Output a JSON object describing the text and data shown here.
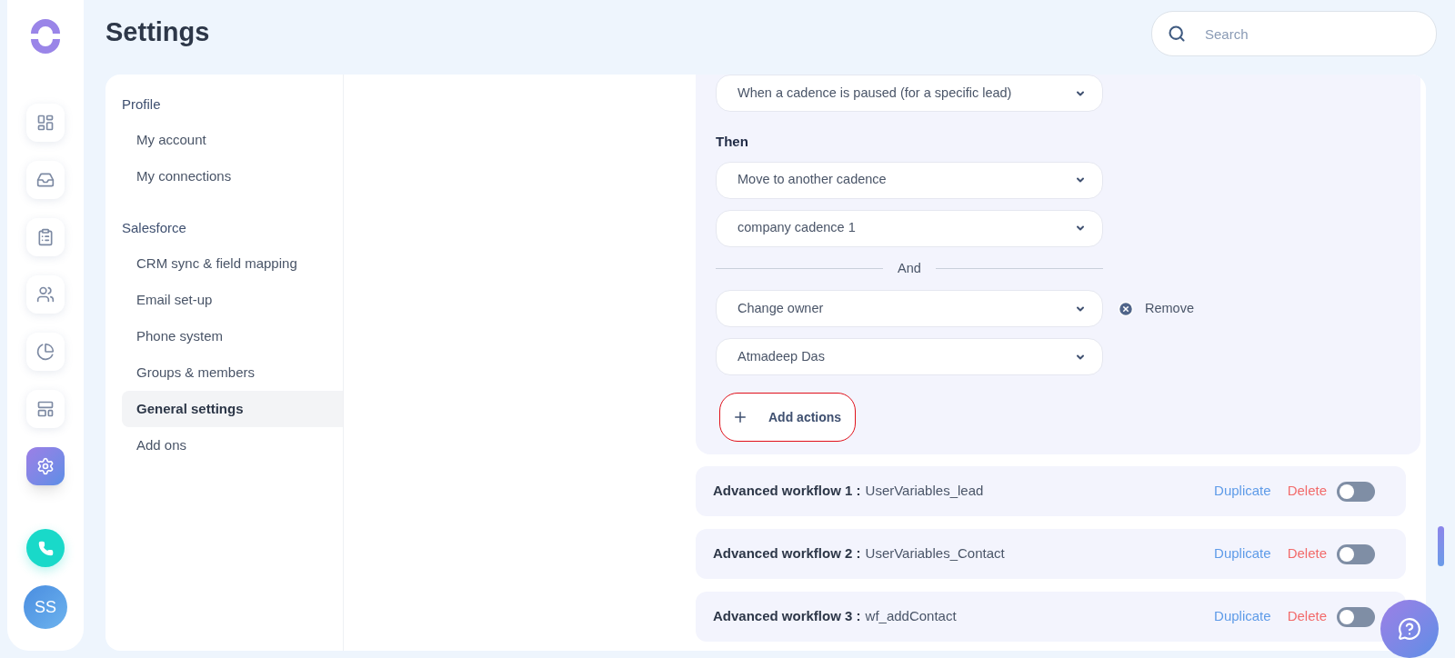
{
  "rail": {
    "items": [
      {
        "kind": "dashboard",
        "selected": false
      },
      {
        "kind": "inbox",
        "selected": false
      },
      {
        "kind": "tasks",
        "selected": false
      },
      {
        "kind": "people",
        "selected": false
      },
      {
        "kind": "reports",
        "selected": false
      },
      {
        "kind": "templates",
        "selected": false
      },
      {
        "kind": "settings",
        "selected": true
      }
    ],
    "avatar": "SS"
  },
  "header": {
    "title": "Settings",
    "search": {
      "placeholder": "Search"
    }
  },
  "nav": {
    "sections": [
      {
        "title": "Profile",
        "items": [
          {
            "label": "My account",
            "selected": false
          },
          {
            "label": "My connections",
            "selected": false
          }
        ]
      },
      {
        "title": "Salesforce",
        "items": [
          {
            "label": "CRM sync & field mapping",
            "selected": false
          },
          {
            "label": "Email set-up",
            "selected": false
          },
          {
            "label": "Phone system",
            "selected": false
          },
          {
            "label": "Groups & members",
            "selected": false
          },
          {
            "label": "General settings",
            "selected": true
          },
          {
            "label": "Add ons",
            "selected": false
          }
        ]
      }
    ]
  },
  "editor": {
    "trigger": "When a cadence is paused (for a specific lead)",
    "then_label": "Then",
    "actions": [
      {
        "kind": "select",
        "value": "Move to another cadence"
      },
      {
        "kind": "select",
        "value": "company cadence 1"
      },
      {
        "kind": "divider",
        "label": "And"
      },
      {
        "kind": "select",
        "value": "Change owner",
        "remove": "Remove"
      },
      {
        "kind": "select",
        "value": "Atmadeep Das"
      }
    ],
    "add_button": "Add actions"
  },
  "workflows": [
    {
      "title": "Advanced workflow 1 :",
      "name": "UserVariables_lead",
      "duplicate": "Duplicate",
      "delete": "Delete",
      "on": false
    },
    {
      "title": "Advanced workflow 2 :",
      "name": "UserVariables_Contact",
      "duplicate": "Duplicate",
      "delete": "Delete",
      "on": false
    },
    {
      "title": "Advanced workflow 3 :",
      "name": "wf_addContact",
      "duplicate": "Duplicate",
      "delete": "Delete",
      "on": false
    }
  ]
}
